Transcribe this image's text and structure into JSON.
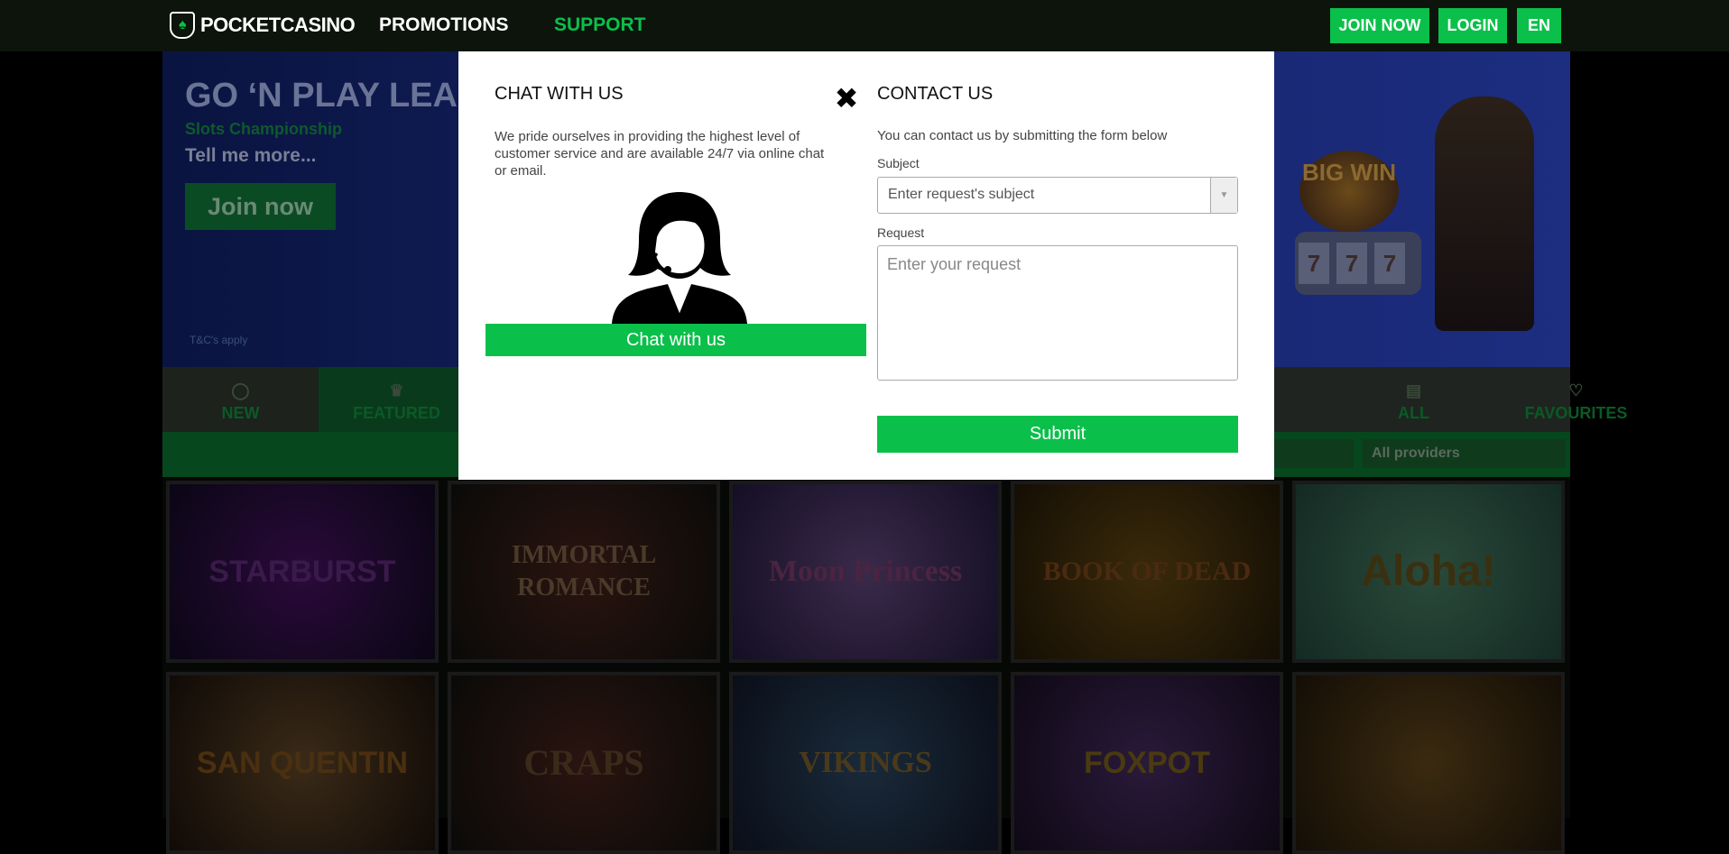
{
  "header": {
    "logo_text": "POCKETCASINO",
    "nav": {
      "promotions": "PROMOTIONS",
      "support": "SUPPORT"
    },
    "join_label": "JOIN NOW",
    "login_label": "LOGIN",
    "language": "EN"
  },
  "hero": {
    "title": "GO ‘N PLAY LEAGUE",
    "subtitle": "Slots Championship",
    "tell_more": "Tell me more...",
    "join_label": "Join now",
    "terms": "T&C's apply",
    "bigwin_text": "BIG WIN",
    "slot_digits": [
      "7",
      "7",
      "7"
    ]
  },
  "tabs": {
    "new": "NEW",
    "featured": "FEATURED",
    "all": "ALL",
    "favourites": "FAVOURITES"
  },
  "filters": {
    "provider": "All providers"
  },
  "games": [
    "STARBURST",
    "IMMORTAL ROMANCE",
    "Moon Princess",
    "BOOK OF DEAD",
    "Aloha!",
    "SAN QUENTIN",
    "CRAPS",
    "VIKINGS",
    "FOXPOT",
    ""
  ],
  "modal": {
    "chat_title": "CHAT WITH US",
    "chat_text": "We pride ourselves in providing the highest level of customer service and are available 24/7 via online chat or email.",
    "chat_button": "Chat with us",
    "contact_title": "CONTACT US",
    "contact_text": "You can contact us by submitting the form below",
    "subject_label": "Subject",
    "subject_placeholder": "Enter request's subject",
    "request_label": "Request",
    "request_placeholder": "Enter your request",
    "submit_label": "Submit"
  },
  "colors": {
    "accent": "#0ac04a",
    "header_bg": "#0c140c"
  }
}
